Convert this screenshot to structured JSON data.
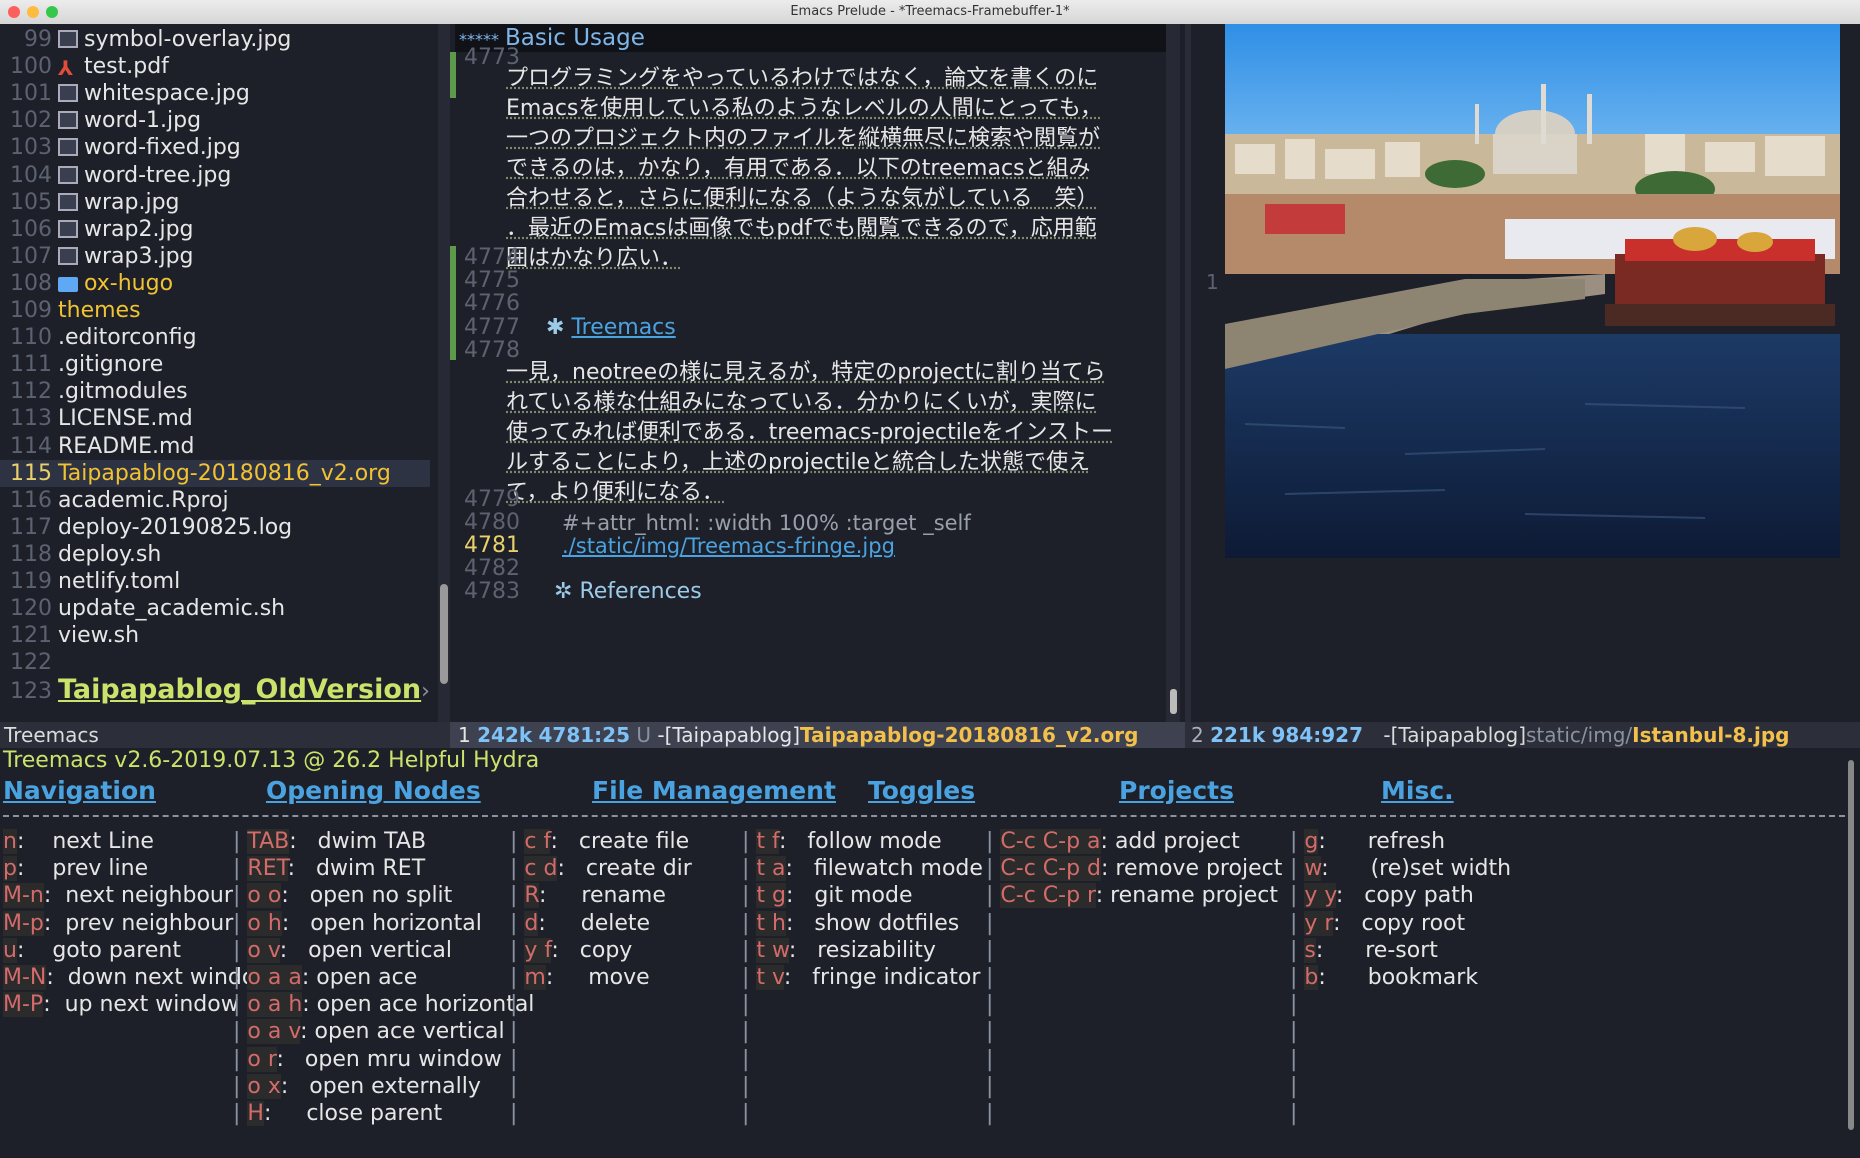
{
  "window_title": "Emacs Prelude -  *Treemacs-Framebuffer-1*",
  "treemacs": {
    "rows": [
      {
        "num": "99",
        "name": "symbol-overlay.jpg",
        "icon": "image-icon"
      },
      {
        "num": "100",
        "name": "test.pdf",
        "icon": "pdf-icon"
      },
      {
        "num": "101",
        "name": "whitespace.jpg",
        "icon": "image-icon"
      },
      {
        "num": "102",
        "name": "word-1.jpg",
        "icon": "image-icon"
      },
      {
        "num": "103",
        "name": "word-fixed.jpg",
        "icon": "image-icon"
      },
      {
        "num": "104",
        "name": "word-tree.jpg",
        "icon": "image-icon"
      },
      {
        "num": "105",
        "name": "wrap.jpg",
        "icon": "image-icon"
      },
      {
        "num": "106",
        "name": "wrap2.jpg",
        "icon": "image-icon"
      },
      {
        "num": "107",
        "name": "wrap3.jpg",
        "icon": "image-icon"
      },
      {
        "num": "108",
        "name": "ox-hugo",
        "icon": "folder-icon"
      },
      {
        "num": "109",
        "name": "themes",
        "icon": ""
      },
      {
        "num": "110",
        "name": ".editorconfig",
        "icon": ""
      },
      {
        "num": "111",
        "name": ".gitignore",
        "icon": ""
      },
      {
        "num": "112",
        "name": ".gitmodules",
        "icon": ""
      },
      {
        "num": "113",
        "name": "LICENSE.md",
        "icon": ""
      },
      {
        "num": "114",
        "name": "README.md",
        "icon": ""
      },
      {
        "num": "115",
        "name": "Taipapablog-20180816_v2.org",
        "icon": ""
      },
      {
        "num": "116",
        "name": "academic.Rproj",
        "icon": ""
      },
      {
        "num": "117",
        "name": "deploy-20190825.log",
        "icon": ""
      },
      {
        "num": "118",
        "name": "deploy.sh",
        "icon": ""
      },
      {
        "num": "119",
        "name": "netlify.toml",
        "icon": ""
      },
      {
        "num": "120",
        "name": "update_academic.sh",
        "icon": ""
      },
      {
        "num": "121",
        "name": "view.sh",
        "icon": ""
      },
      {
        "num": "122",
        "name": "",
        "icon": ""
      },
      {
        "num": "123",
        "name": "Taipapablog_OldVersion",
        "icon": ""
      }
    ],
    "more_marker": "›"
  },
  "org": {
    "header_stars": "*****",
    "header_title": "Basic Usage",
    "lines": {
      "l4773": "4773",
      "l4774": "4774",
      "l4775": "4775",
      "l4776": "4776",
      "l4777": "4777",
      "l4778": "4778",
      "l4779": "4779",
      "l4780": "4780",
      "l4781": "4781",
      "l4782": "4782",
      "l4783": "4783"
    },
    "para1": [
      "プログラミングをやっているわけではなく，論文を書くのに",
      "Emacsを使用している私のようなレベルの人間にとっても，",
      "一つのプロジェクト内のファイルを縦横無尽に検索や閲覧が",
      "できるのは，かなり，有用である．以下のtreemacsと組み",
      "合わせると，さらに便利になる（ような気がしている　笑）",
      "．最近のEmacsは画像でもpdfでも閲覧できるので，応用範",
      "囲はかなり広い．"
    ],
    "heading_bullet": "✱",
    "heading_treemacs": "Treemacs",
    "para2": [
      "一見，neotreeの様に見えるが，特定のprojectに割り当てら",
      "れている様な仕組みになっている．分かりにくいが，実際に",
      "使ってみれば便利である．treemacs-projectileをインストー",
      "ルすることにより，上述のprojectileと統合した状態で使え",
      "て，より便利になる．"
    ],
    "attr_line": "#+attr_html: :width 100% :target _self",
    "link_line": "./static/img/Treemacs-fringe.jpg",
    "references_bullet": "✲",
    "references": "References"
  },
  "image_pane": {
    "fringe_marker": "1"
  },
  "modelines": {
    "treemacs": "Treemacs",
    "org_win": "1",
    "org_size": "242k",
    "org_pos": "4781:25",
    "org_flags": "U",
    "org_project": "-[Taipapablog]",
    "org_file": "Taipapablog-20180816_v2.org",
    "img_win": "2",
    "img_size": "221k",
    "img_pos": "984:927",
    "img_project": "-[Taipapablog]",
    "img_dir": "static/img/",
    "img_file": "Istanbul-8.jpg"
  },
  "hydra": {
    "title": "Treemacs v2.6-2019.07.13 @ 26.2 Helpful Hydra",
    "headings": [
      "Navigation",
      "Opening Nodes",
      "File Management",
      "Toggles",
      "Projects",
      "Misc."
    ],
    "rows": [
      [
        [
          "n",
          ":    next Line        "
        ],
        [
          "TAB",
          ":   dwim TAB            "
        ],
        [
          "c f",
          ":   create file "
        ],
        [
          "t f",
          ":   follow mode       "
        ],
        [
          "C-c C-p a",
          ": add project     "
        ],
        [
          "g",
          ":      refresh"
        ]
      ],
      [
        [
          "p",
          ":    prev line       "
        ],
        [
          "RET",
          ":   dwim RET             "
        ],
        [
          "c d",
          ":   create dir   "
        ],
        [
          "t a",
          ":   filewatch mode   "
        ],
        [
          "C-c C-p d",
          ": remove project "
        ],
        [
          "w",
          ":      (re)set width"
        ]
      ],
      [
        [
          "M-n",
          ":  next neighbour  "
        ],
        [
          "o o",
          ":   open no split       "
        ],
        [
          "R",
          ":     rename       "
        ],
        [
          "t g",
          ":   git mode          "
        ],
        [
          "C-c C-p r",
          ": rename project "
        ],
        [
          "y y",
          ":   copy path"
        ]
      ],
      [
        [
          "M-p",
          ":  prev neighbour  "
        ],
        [
          "o h",
          ":   open horizontal     "
        ],
        [
          "d",
          ":     delete        "
        ],
        [
          "t h",
          ":   show dotfiles     "
        ],
        [
          "",
          "                  "
        ],
        [
          "y r",
          ":   copy root"
        ]
      ],
      [
        [
          "u",
          ":    goto parent     "
        ],
        [
          "o v",
          ":   open vertical       "
        ],
        [
          "y f",
          ":   copy         "
        ],
        [
          "t w",
          ":   resizability      "
        ],
        [
          "",
          "                  "
        ],
        [
          "s",
          ":      re-sort"
        ]
      ],
      [
        [
          "M-N",
          ":  down next window "
        ],
        [
          "o a a",
          ": open ace            "
        ],
        [
          "m",
          ":     move         "
        ],
        [
          "t v",
          ":   fringe indicator "
        ],
        [
          "",
          "                  "
        ],
        [
          "b",
          ":      bookmark"
        ]
      ],
      [
        [
          "M-P",
          ":  up next window  "
        ],
        [
          "o a h",
          ": open ace horizontal "
        ],
        [
          "",
          "              "
        ],
        [
          "",
          "                   "
        ],
        [
          "",
          "                  "
        ],
        [
          "",
          ""
        ]
      ],
      [
        [
          "",
          "                  "
        ],
        [
          "o a v",
          ": open ace vertical   "
        ],
        [
          "",
          "              "
        ],
        [
          "",
          "                   "
        ],
        [
          "",
          "                  "
        ],
        [
          "",
          ""
        ]
      ],
      [
        [
          "",
          "                  "
        ],
        [
          "o r",
          ":   open mru window     "
        ],
        [
          "",
          "              "
        ],
        [
          "",
          "                   "
        ],
        [
          "",
          "                  "
        ],
        [
          "",
          ""
        ]
      ],
      [
        [
          "",
          "                  "
        ],
        [
          "o x",
          ":   open externally     "
        ],
        [
          "",
          "              "
        ],
        [
          "",
          "                   "
        ],
        [
          "",
          "                  "
        ],
        [
          "",
          ""
        ]
      ],
      [
        [
          "",
          "                  "
        ],
        [
          "H",
          ":     close parent        "
        ],
        [
          "",
          "              "
        ],
        [
          "",
          "                   "
        ],
        [
          "",
          "                  "
        ],
        [
          "",
          ""
        ]
      ]
    ]
  }
}
